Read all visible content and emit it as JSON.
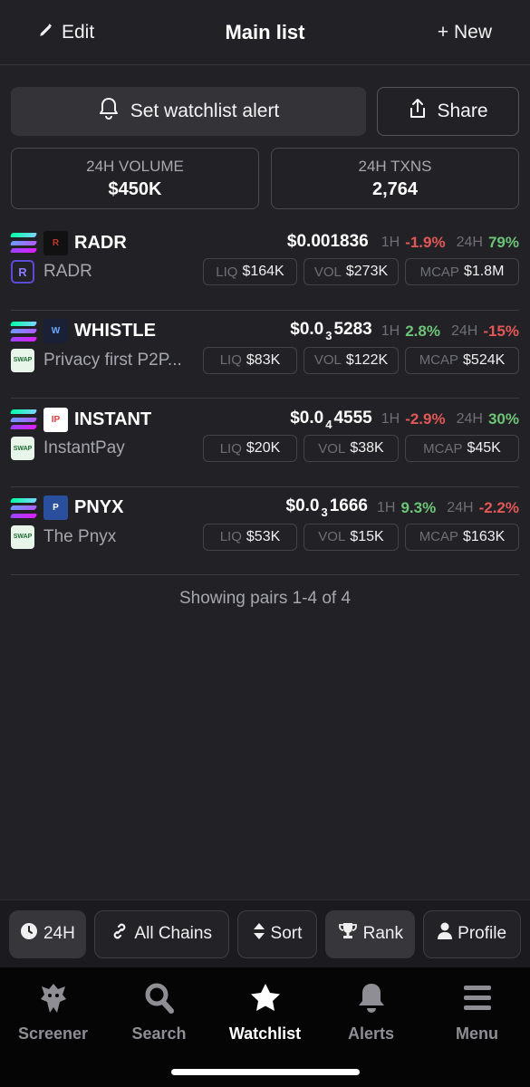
{
  "header": {
    "edit_label": "Edit",
    "title": "Main list",
    "new_label": "+ New"
  },
  "actions": {
    "alert_label": "Set watchlist alert",
    "share_label": "Share"
  },
  "stats": {
    "volume_label": "24H VOLUME",
    "volume_value": "$450K",
    "txns_label": "24H TXNS",
    "txns_value": "2,764"
  },
  "pairs": [
    {
      "symbol": "RADR",
      "name": "RADR",
      "dex_icon": "raydium-icon",
      "price_prefix": "$0.001836",
      "price_sub": "",
      "price_tail": "",
      "h1_label": "1H",
      "h1": "-1.9%",
      "h1_dir": "neg",
      "h24_label": "24H",
      "h24": "79%",
      "h24_dir": "pos",
      "liq_label": "LIQ",
      "liq": "$164K",
      "vol_label": "VOL",
      "vol": "$273K",
      "mcap_label": "MCAP",
      "mcap": "$1.8M",
      "logo_bg": "#111111",
      "logo_fg": "#c0392b",
      "logo_text": "R"
    },
    {
      "symbol": "WHISTLE",
      "name": "Privacy first P2P...",
      "dex_icon": "swap-icon",
      "price_prefix": "$0.0",
      "price_sub": "3",
      "price_tail": "5283",
      "h1_label": "1H",
      "h1": "2.8%",
      "h1_dir": "pos",
      "h24_label": "24H",
      "h24": "-15%",
      "h24_dir": "neg",
      "liq_label": "LIQ",
      "liq": "$83K",
      "vol_label": "VOL",
      "vol": "$122K",
      "mcap_label": "MCAP",
      "mcap": "$524K",
      "logo_bg": "#1a2036",
      "logo_fg": "#6fa8ff",
      "logo_text": "W"
    },
    {
      "symbol": "INSTANT",
      "name": "InstantPay",
      "dex_icon": "swap-icon",
      "price_prefix": "$0.0",
      "price_sub": "4",
      "price_tail": "4555",
      "h1_label": "1H",
      "h1": "-2.9%",
      "h1_dir": "neg",
      "h24_label": "24H",
      "h24": "30%",
      "h24_dir": "pos",
      "liq_label": "LIQ",
      "liq": "$20K",
      "vol_label": "VOL",
      "vol": "$38K",
      "mcap_label": "MCAP",
      "mcap": "$45K",
      "logo_bg": "#ffffff",
      "logo_fg": "#e23b3b",
      "logo_text": "IP"
    },
    {
      "symbol": "PNYX",
      "name": "The Pnyx",
      "dex_icon": "swap-icon",
      "price_prefix": "$0.0",
      "price_sub": "3",
      "price_tail": "1666",
      "h1_label": "1H",
      "h1": "9.3%",
      "h1_dir": "pos",
      "h24_label": "24H",
      "h24": "-2.2%",
      "h24_dir": "neg",
      "liq_label": "LIQ",
      "liq": "$53K",
      "vol_label": "VOL",
      "vol": "$15K",
      "mcap_label": "MCAP",
      "mcap": "$163K",
      "logo_bg": "#2a4f9c",
      "logo_fg": "#ffffff",
      "logo_text": "P"
    }
  ],
  "showing_text": "Showing pairs 1-4 of 4",
  "filters": {
    "timeframe": "24H",
    "chains": "All Chains",
    "sort": "Sort",
    "rank": "Rank",
    "profile": "Profile"
  },
  "nav": {
    "screener": "Screener",
    "search": "Search",
    "watchlist": "Watchlist",
    "alerts": "Alerts",
    "menu": "Menu"
  },
  "colors": {
    "positive": "#6cc477",
    "negative": "#e25757",
    "background": "#222226"
  }
}
